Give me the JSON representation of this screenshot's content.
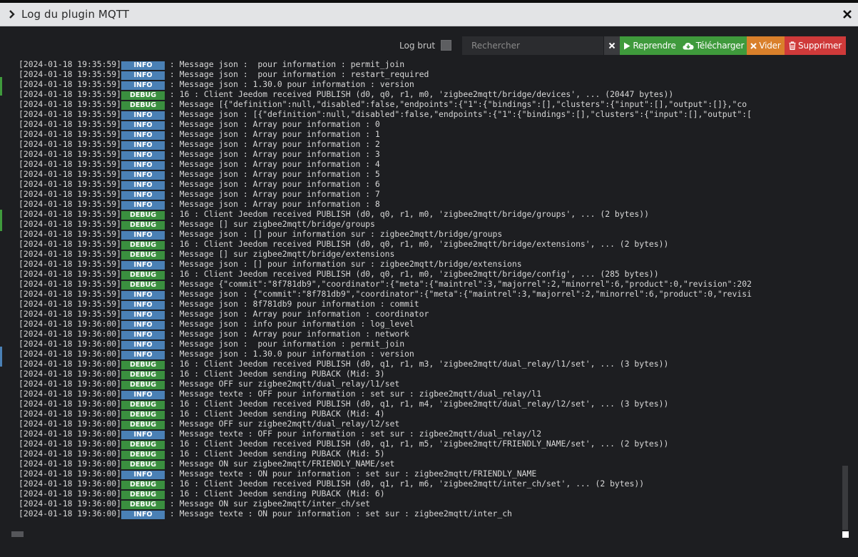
{
  "window": {
    "title": "Log du plugin MQTT"
  },
  "toolbar": {
    "log_brut_label": "Log brut",
    "search_placeholder": "Rechercher",
    "reprendre_label": "Reprendre",
    "telecharger_label": "Télécharger",
    "vider_label": "Vider",
    "supprimer_label": "Supprimer"
  },
  "colors": {
    "info": "#4a80b5",
    "debug": "#3a8f3f",
    "reprendre": "#3f9a3c",
    "vider": "#d9802b",
    "supprimer": "#cf3a3a"
  },
  "icons": {
    "title_chevron": "chevron-right-icon",
    "close": "close-icon",
    "clear": "clear-x-icon",
    "reprendre": "play-icon",
    "telecharger": "cloud-download-icon",
    "vider": "x-icon",
    "supprimer": "trash-icon"
  },
  "log": [
    {
      "ts": "[2024-01-18 19:35:59]",
      "level": "INFO",
      "msg": ": Message json :  pour information : permit_join"
    },
    {
      "ts": "[2024-01-18 19:35:59]",
      "level": "INFO",
      "msg": ": Message json :  pour information : restart_required"
    },
    {
      "ts": "[2024-01-18 19:35:59]",
      "level": "INFO",
      "msg": ": Message json : 1.30.0 pour information : version"
    },
    {
      "ts": "[2024-01-18 19:35:59]",
      "level": "DEBUG",
      "msg": ": 16 : Client Jeedom received PUBLISH (d0, q0, r1, m0, 'zigbee2mqtt/bridge/devices', ... (20447 bytes))"
    },
    {
      "ts": "[2024-01-18 19:35:59]",
      "level": "DEBUG",
      "msg": ": Message [{\"definition\":null,\"disabled\":false,\"endpoints\":{\"1\":{\"bindings\":[],\"clusters\":{\"input\":[],\"output\":[]},\"co"
    },
    {
      "ts": "[2024-01-18 19:35:59]",
      "level": "INFO",
      "msg": ": Message json : [{\"definition\":null,\"disabled\":false,\"endpoints\":{\"1\":{\"bindings\":[],\"clusters\":{\"input\":[],\"output\":["
    },
    {
      "ts": "[2024-01-18 19:35:59]",
      "level": "INFO",
      "msg": ": Message json : Array pour information : 0"
    },
    {
      "ts": "[2024-01-18 19:35:59]",
      "level": "INFO",
      "msg": ": Message json : Array pour information : 1"
    },
    {
      "ts": "[2024-01-18 19:35:59]",
      "level": "INFO",
      "msg": ": Message json : Array pour information : 2"
    },
    {
      "ts": "[2024-01-18 19:35:59]",
      "level": "INFO",
      "msg": ": Message json : Array pour information : 3"
    },
    {
      "ts": "[2024-01-18 19:35:59]",
      "level": "INFO",
      "msg": ": Message json : Array pour information : 4"
    },
    {
      "ts": "[2024-01-18 19:35:59]",
      "level": "INFO",
      "msg": ": Message json : Array pour information : 5"
    },
    {
      "ts": "[2024-01-18 19:35:59]",
      "level": "INFO",
      "msg": ": Message json : Array pour information : 6"
    },
    {
      "ts": "[2024-01-18 19:35:59]",
      "level": "INFO",
      "msg": ": Message json : Array pour information : 7"
    },
    {
      "ts": "[2024-01-18 19:35:59]",
      "level": "INFO",
      "msg": ": Message json : Array pour information : 8"
    },
    {
      "ts": "[2024-01-18 19:35:59]",
      "level": "DEBUG",
      "msg": ": 16 : Client Jeedom received PUBLISH (d0, q0, r1, m0, 'zigbee2mqtt/bridge/groups', ... (2 bytes))"
    },
    {
      "ts": "[2024-01-18 19:35:59]",
      "level": "DEBUG",
      "msg": ": Message [] sur zigbee2mqtt/bridge/groups"
    },
    {
      "ts": "[2024-01-18 19:35:59]",
      "level": "INFO",
      "msg": ": Message json : [] pour information sur : zigbee2mqtt/bridge/groups"
    },
    {
      "ts": "[2024-01-18 19:35:59]",
      "level": "DEBUG",
      "msg": ": 16 : Client Jeedom received PUBLISH (d0, q0, r1, m0, 'zigbee2mqtt/bridge/extensions', ... (2 bytes))"
    },
    {
      "ts": "[2024-01-18 19:35:59]",
      "level": "DEBUG",
      "msg": ": Message [] sur zigbee2mqtt/bridge/extensions"
    },
    {
      "ts": "[2024-01-18 19:35:59]",
      "level": "INFO",
      "msg": ": Message json : [] pour information sur : zigbee2mqtt/bridge/extensions"
    },
    {
      "ts": "[2024-01-18 19:35:59]",
      "level": "DEBUG",
      "msg": ": 16 : Client Jeedom received PUBLISH (d0, q0, r1, m0, 'zigbee2mqtt/bridge/config', ... (285 bytes))"
    },
    {
      "ts": "[2024-01-18 19:35:59]",
      "level": "DEBUG",
      "msg": ": Message {\"commit\":\"8f781db9\",\"coordinator\":{\"meta\":{\"maintrel\":3,\"majorrel\":2,\"minorrel\":6,\"product\":0,\"revision\":202"
    },
    {
      "ts": "[2024-01-18 19:35:59]",
      "level": "INFO",
      "msg": ": Message json : {\"commit\":\"8f781db9\",\"coordinator\":{\"meta\":{\"maintrel\":3,\"majorrel\":2,\"minorrel\":6,\"product\":0,\"revisi"
    },
    {
      "ts": "[2024-01-18 19:35:59]",
      "level": "INFO",
      "msg": ": Message json : 8f781db9 pour information : commit"
    },
    {
      "ts": "[2024-01-18 19:35:59]",
      "level": "INFO",
      "msg": ": Message json : Array pour information : coordinator"
    },
    {
      "ts": "[2024-01-18 19:36:00]",
      "level": "INFO",
      "msg": ": Message json : info pour information : log_level"
    },
    {
      "ts": "[2024-01-18 19:36:00]",
      "level": "INFO",
      "msg": ": Message json : Array pour information : network"
    },
    {
      "ts": "[2024-01-18 19:36:00]",
      "level": "INFO",
      "msg": ": Message json :  pour information : permit_join"
    },
    {
      "ts": "[2024-01-18 19:36:00]",
      "level": "INFO",
      "msg": ": Message json : 1.30.0 pour information : version"
    },
    {
      "ts": "[2024-01-18 19:36:00]",
      "level": "DEBUG",
      "msg": ": 16 : Client Jeedom received PUBLISH (d0, q1, r1, m3, 'zigbee2mqtt/dual_relay/l1/set', ... (3 bytes))"
    },
    {
      "ts": "[2024-01-18 19:36:00]",
      "level": "DEBUG",
      "msg": ": 16 : Client Jeedom sending PUBACK (Mid: 3)"
    },
    {
      "ts": "[2024-01-18 19:36:00]",
      "level": "DEBUG",
      "msg": ": Message OFF sur zigbee2mqtt/dual_relay/l1/set"
    },
    {
      "ts": "[2024-01-18 19:36:00]",
      "level": "INFO",
      "msg": ": Message texte : OFF pour information : set sur : zigbee2mqtt/dual_relay/l1"
    },
    {
      "ts": "[2024-01-18 19:36:00]",
      "level": "DEBUG",
      "msg": ": 16 : Client Jeedom received PUBLISH (d0, q1, r1, m4, 'zigbee2mqtt/dual_relay/l2/set', ... (3 bytes))"
    },
    {
      "ts": "[2024-01-18 19:36:00]",
      "level": "DEBUG",
      "msg": ": 16 : Client Jeedom sending PUBACK (Mid: 4)"
    },
    {
      "ts": "[2024-01-18 19:36:00]",
      "level": "DEBUG",
      "msg": ": Message OFF sur zigbee2mqtt/dual_relay/l2/set"
    },
    {
      "ts": "[2024-01-18 19:36:00]",
      "level": "INFO",
      "msg": ": Message texte : OFF pour information : set sur : zigbee2mqtt/dual_relay/l2"
    },
    {
      "ts": "[2024-01-18 19:36:00]",
      "level": "DEBUG",
      "msg": ": 16 : Client Jeedom received PUBLISH (d0, q1, r1, m5, 'zigbee2mqtt/FRIENDLY_NAME/set', ... (2 bytes))"
    },
    {
      "ts": "[2024-01-18 19:36:00]",
      "level": "DEBUG",
      "msg": ": 16 : Client Jeedom sending PUBACK (Mid: 5)"
    },
    {
      "ts": "[2024-01-18 19:36:00]",
      "level": "DEBUG",
      "msg": ": Message ON sur zigbee2mqtt/FRIENDLY_NAME/set"
    },
    {
      "ts": "[2024-01-18 19:36:00]",
      "level": "INFO",
      "msg": ": Message texte : ON pour information : set sur : zigbee2mqtt/FRIENDLY_NAME"
    },
    {
      "ts": "[2024-01-18 19:36:00]",
      "level": "DEBUG",
      "msg": ": 16 : Client Jeedom received PUBLISH (d0, q1, r1, m6, 'zigbee2mqtt/inter_ch/set', ... (2 bytes))"
    },
    {
      "ts": "[2024-01-18 19:36:00]",
      "level": "DEBUG",
      "msg": ": 16 : Client Jeedom sending PUBACK (Mid: 6)"
    },
    {
      "ts": "[2024-01-18 19:36:00]",
      "level": "DEBUG",
      "msg": ": Message ON sur zigbee2mqtt/inter_ch/set"
    },
    {
      "ts": "[2024-01-18 19:36:00]",
      "level": "INFO",
      "msg": ": Message texte : ON pour information : set sur : zigbee2mqtt/inter_ch"
    }
  ]
}
